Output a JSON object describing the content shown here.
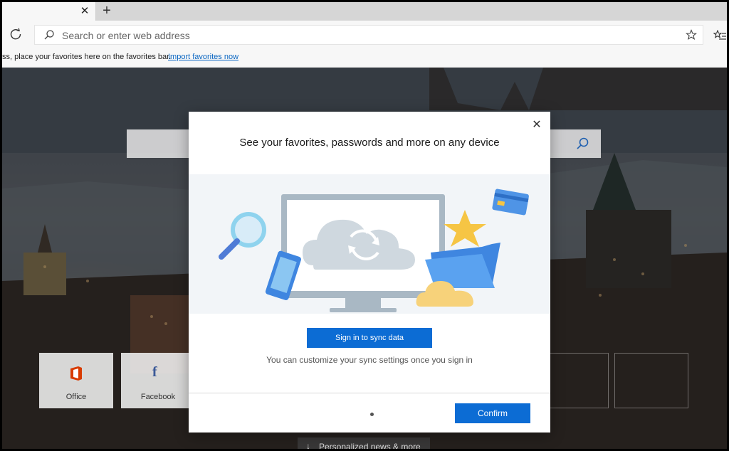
{
  "tabstrip": {
    "close_glyph": "✕",
    "newtab_glyph": "+"
  },
  "toolbar": {
    "address_placeholder": "Search or enter web address"
  },
  "favbar": {
    "message": "ss, place your favorites here on the favorites bar.",
    "import_link": "Import favorites now"
  },
  "ntp": {
    "tiles": [
      {
        "label": "Office"
      },
      {
        "label": "Facebook"
      }
    ],
    "news_arrow": "↓",
    "news_label": "Personalized news & more"
  },
  "modal": {
    "close_glyph": "✕",
    "title": "See your favorites, passwords and more on any device",
    "sync_button": "Sign in to sync data",
    "hint": "You can customize your sync settings once you sign in",
    "confirm_button": "Confirm"
  },
  "colors": {
    "accent": "#0c6cd4",
    "office": "#d83b01",
    "facebook": "#3b5998"
  }
}
